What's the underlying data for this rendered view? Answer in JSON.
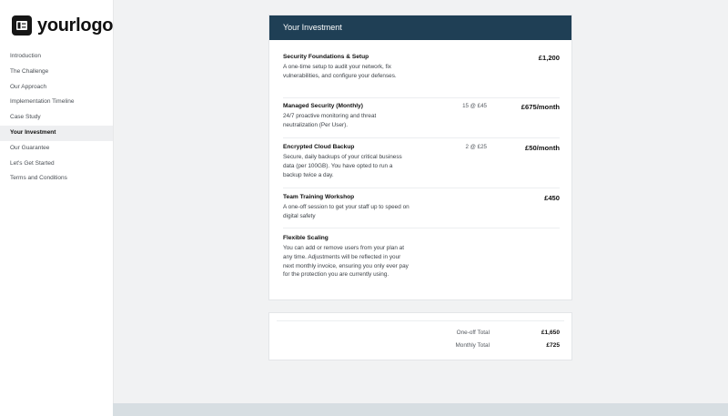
{
  "logo": {
    "text": "yourlogo"
  },
  "nav": {
    "items": [
      {
        "label": "Introduction"
      },
      {
        "label": "The Challenge"
      },
      {
        "label": "Our Approach"
      },
      {
        "label": "Implementation Timeline"
      },
      {
        "label": "Case Study"
      },
      {
        "label": "Your Investment",
        "active": true
      },
      {
        "label": "Our Guarantee"
      },
      {
        "label": "Let's Get Started"
      },
      {
        "label": "Terms and Conditions"
      }
    ]
  },
  "investment": {
    "title": "Your Investment",
    "items": [
      {
        "title": "Security Foundations & Setup",
        "description": "A one-time setup to audit your network, fix vulnerabilities, and configure your defenses.",
        "qty": "",
        "price": "£1,200"
      },
      {
        "title": "Managed Security (Monthly)",
        "description": "24/7 proactive monitoring and threat neutralization (Per User).",
        "qty": "15 @ £45",
        "price": "£675/month"
      },
      {
        "title": "Encrypted Cloud Backup",
        "description": "Secure, daily backups of your critical business data (per 100GB). You have opted to run a backup twice a day.",
        "qty": "2 @ £25",
        "price": "£50/month"
      },
      {
        "title": "Team Training Workshop",
        "description": "A one-off session to get your staff up to speed on digital safety",
        "qty": "",
        "price": "£450"
      },
      {
        "title": "Flexible Scaling",
        "description": "You can add or remove users from your plan at any time. Adjustments will be reflected in your next monthly invoice, ensuring you only ever pay for the protection you are currently using.",
        "qty": "",
        "price": ""
      }
    ]
  },
  "totals": {
    "oneoff_label": "One-off Total",
    "oneoff_value": "£1,650",
    "monthly_label": "Monthly Total",
    "monthly_value": "£725"
  },
  "colors": {
    "header": "#1f3f55",
    "background": "#f1f2f3",
    "active_nav": "#eeeff1"
  }
}
